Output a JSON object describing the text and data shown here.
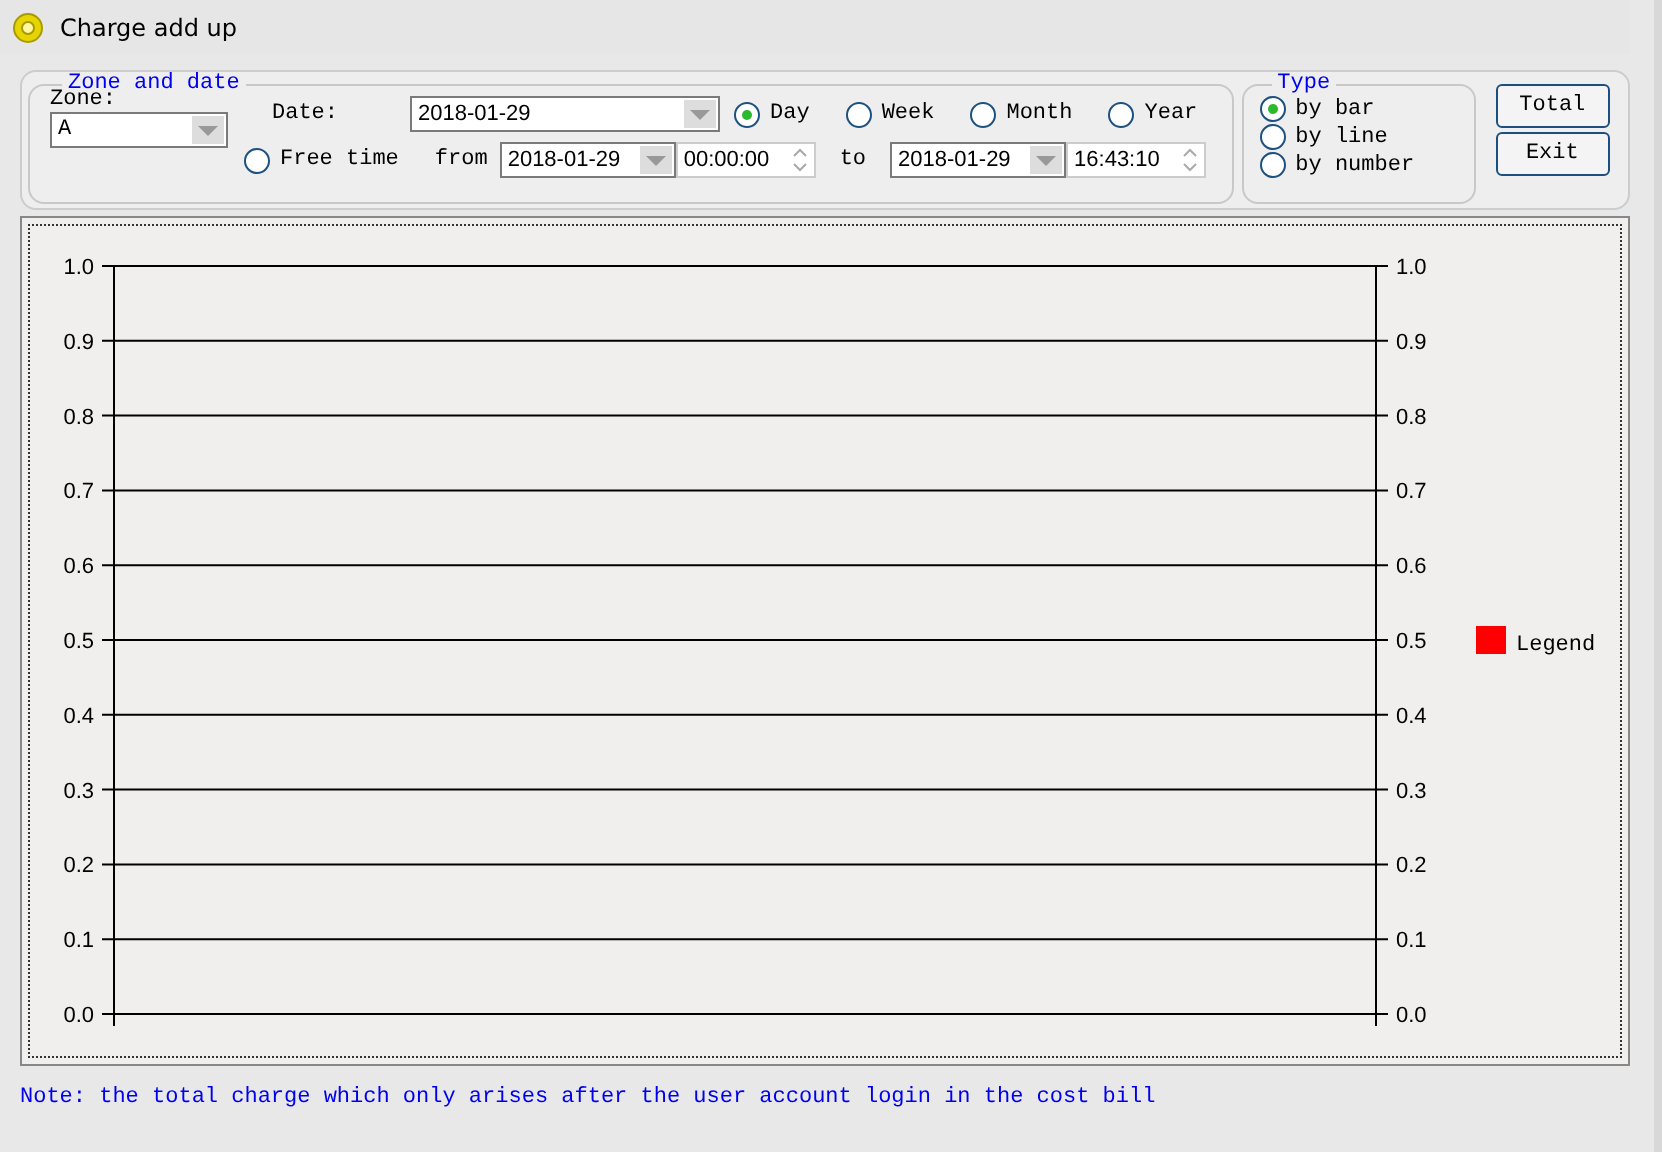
{
  "window": {
    "title": "Charge add up"
  },
  "zone_and_date": {
    "title": "Zone and date",
    "zone": {
      "label": "Zone:",
      "value": "A"
    },
    "date": {
      "label": "Date:",
      "value": "2018-01-29"
    },
    "periods": [
      {
        "label": "Day",
        "selected": true
      },
      {
        "label": "Week",
        "selected": false
      },
      {
        "label": "Month",
        "selected": false
      },
      {
        "label": "Year",
        "selected": false
      }
    ],
    "free_time": {
      "label": "Free time",
      "selected": false
    },
    "from": {
      "label": "from",
      "date": "2018-01-29",
      "time": "00:00:00"
    },
    "to": {
      "label": "to",
      "date": "2018-01-29",
      "time": "16:43:10"
    }
  },
  "type": {
    "title": "Type",
    "options": [
      {
        "label": "by bar",
        "selected": true
      },
      {
        "label": "by line",
        "selected": false
      },
      {
        "label": "by number",
        "selected": false
      }
    ]
  },
  "buttons": [
    "Total",
    "Exit"
  ],
  "chart": {
    "chart_data": {
      "type": "bar",
      "grid": true,
      "ylim": [
        0,
        1
      ],
      "yticks": [
        {
          "value": 0,
          "label": "0.0"
        },
        {
          "value": 0.1,
          "label": "0.1"
        },
        {
          "value": 0.2,
          "label": "0.2"
        },
        {
          "value": 0.3,
          "label": "0.3"
        },
        {
          "value": 0.4,
          "label": "0.4"
        },
        {
          "value": 0.5,
          "label": "0.5"
        },
        {
          "value": 0.6,
          "label": "0.6"
        },
        {
          "value": 0.7,
          "label": "0.7"
        },
        {
          "value": 0.8,
          "label": "0.8"
        },
        {
          "value": 0.9,
          "label": "0.9"
        },
        {
          "value": 1,
          "label": "1.0"
        }
      ],
      "series": [
        {
          "name": "Legend",
          "color": "#ff0000"
        }
      ]
    },
    "right_axis_labels": [
      "1.0",
      "0.9",
      "0.8",
      "0.7",
      "0.6",
      "0.5",
      "0.4",
      "0.3",
      "0.2",
      "0.1",
      "0.0"
    ]
  },
  "note": "Note: the total charge which only arises after the user account login in the cost bill"
}
